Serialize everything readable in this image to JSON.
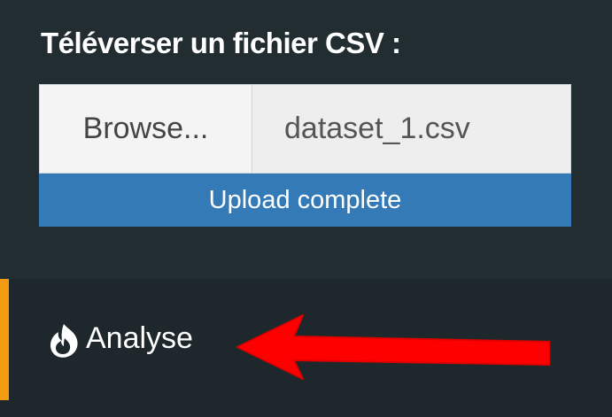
{
  "upload": {
    "label": "Téléverser un fichier CSV :",
    "browse_label": "Browse...",
    "filename": "dataset_1.csv",
    "progress_text": "Upload complete",
    "progress_percent": 100
  },
  "sidebar": {
    "active_item": {
      "label": "Analyse",
      "icon": "fire-icon",
      "active": true
    }
  },
  "annotation": {
    "arrow_icon": "left-arrow-icon",
    "color": "#ff0000",
    "points_to": "Analyse"
  },
  "colors": {
    "sidebar_background": "#222d32",
    "active_item_background": "#1e282c",
    "progress_fill": "#337ab7",
    "active_indicator": "#f39c12",
    "annotation_arrow": "#ff0000"
  }
}
